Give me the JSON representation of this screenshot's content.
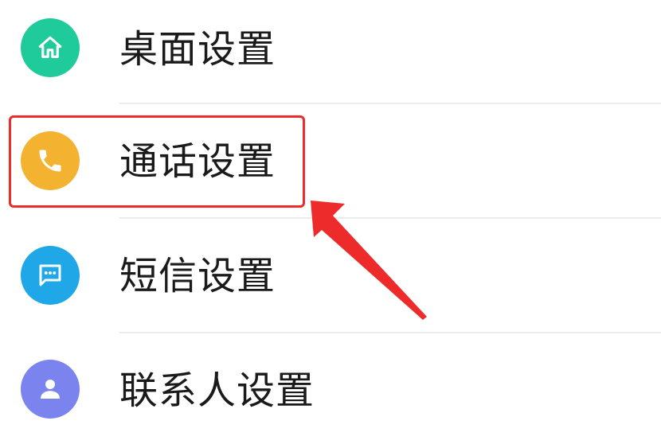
{
  "settings": {
    "items": [
      {
        "label": "桌面设置",
        "icon": "home-icon",
        "color": "#1fcb9a"
      },
      {
        "label": "通话设置",
        "icon": "phone-icon",
        "color": "#f3b330"
      },
      {
        "label": "短信设置",
        "icon": "message-icon",
        "color": "#1fa7e8"
      },
      {
        "label": "联系人设置",
        "icon": "contact-icon",
        "color": "#7b83ef"
      }
    ]
  },
  "annotation": {
    "highlight_color": "#ee2b2b",
    "highlighted_item": "通话设置"
  }
}
